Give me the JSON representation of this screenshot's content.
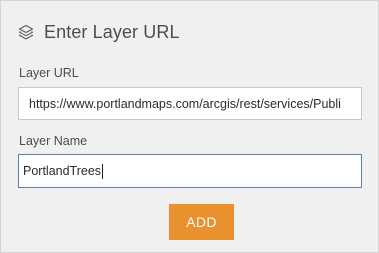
{
  "header": {
    "icon": "layers-icon",
    "title": "Enter Layer URL"
  },
  "form": {
    "url_label": "Layer URL",
    "url_value": "https://www.portlandmaps.com/arcgis/rest/services/Publi",
    "name_label": "Layer Name",
    "name_value": "PortlandTrees",
    "add_label": "ADD"
  },
  "colors": {
    "panel_bg": "#f0f0f0",
    "accent": "#e8912e",
    "focus_border": "#5a7fb0"
  }
}
